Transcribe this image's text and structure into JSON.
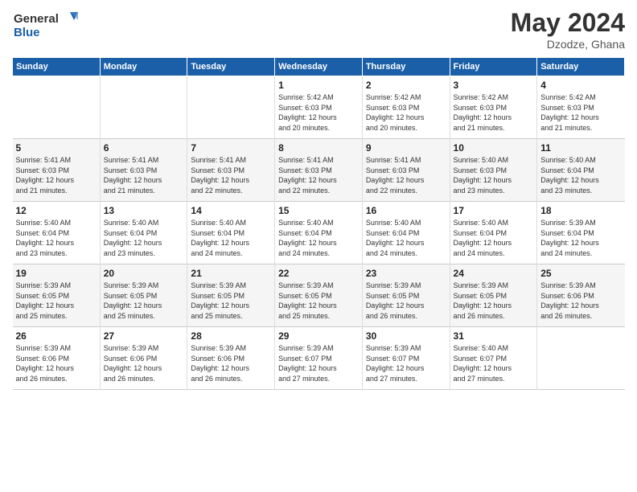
{
  "logo": {
    "line1": "General",
    "line2": "Blue"
  },
  "title": "May 2024",
  "location": "Dzodze, Ghana",
  "days_of_week": [
    "Sunday",
    "Monday",
    "Tuesday",
    "Wednesday",
    "Thursday",
    "Friday",
    "Saturday"
  ],
  "weeks": [
    [
      {
        "day": "",
        "info": ""
      },
      {
        "day": "",
        "info": ""
      },
      {
        "day": "",
        "info": ""
      },
      {
        "day": "1",
        "info": "Sunrise: 5:42 AM\nSunset: 6:03 PM\nDaylight: 12 hours\nand 20 minutes."
      },
      {
        "day": "2",
        "info": "Sunrise: 5:42 AM\nSunset: 6:03 PM\nDaylight: 12 hours\nand 20 minutes."
      },
      {
        "day": "3",
        "info": "Sunrise: 5:42 AM\nSunset: 6:03 PM\nDaylight: 12 hours\nand 21 minutes."
      },
      {
        "day": "4",
        "info": "Sunrise: 5:42 AM\nSunset: 6:03 PM\nDaylight: 12 hours\nand 21 minutes."
      }
    ],
    [
      {
        "day": "5",
        "info": "Sunrise: 5:41 AM\nSunset: 6:03 PM\nDaylight: 12 hours\nand 21 minutes."
      },
      {
        "day": "6",
        "info": "Sunrise: 5:41 AM\nSunset: 6:03 PM\nDaylight: 12 hours\nand 21 minutes."
      },
      {
        "day": "7",
        "info": "Sunrise: 5:41 AM\nSunset: 6:03 PM\nDaylight: 12 hours\nand 22 minutes."
      },
      {
        "day": "8",
        "info": "Sunrise: 5:41 AM\nSunset: 6:03 PM\nDaylight: 12 hours\nand 22 minutes."
      },
      {
        "day": "9",
        "info": "Sunrise: 5:41 AM\nSunset: 6:03 PM\nDaylight: 12 hours\nand 22 minutes."
      },
      {
        "day": "10",
        "info": "Sunrise: 5:40 AM\nSunset: 6:03 PM\nDaylight: 12 hours\nand 23 minutes."
      },
      {
        "day": "11",
        "info": "Sunrise: 5:40 AM\nSunset: 6:04 PM\nDaylight: 12 hours\nand 23 minutes."
      }
    ],
    [
      {
        "day": "12",
        "info": "Sunrise: 5:40 AM\nSunset: 6:04 PM\nDaylight: 12 hours\nand 23 minutes."
      },
      {
        "day": "13",
        "info": "Sunrise: 5:40 AM\nSunset: 6:04 PM\nDaylight: 12 hours\nand 23 minutes."
      },
      {
        "day": "14",
        "info": "Sunrise: 5:40 AM\nSunset: 6:04 PM\nDaylight: 12 hours\nand 24 minutes."
      },
      {
        "day": "15",
        "info": "Sunrise: 5:40 AM\nSunset: 6:04 PM\nDaylight: 12 hours\nand 24 minutes."
      },
      {
        "day": "16",
        "info": "Sunrise: 5:40 AM\nSunset: 6:04 PM\nDaylight: 12 hours\nand 24 minutes."
      },
      {
        "day": "17",
        "info": "Sunrise: 5:40 AM\nSunset: 6:04 PM\nDaylight: 12 hours\nand 24 minutes."
      },
      {
        "day": "18",
        "info": "Sunrise: 5:39 AM\nSunset: 6:04 PM\nDaylight: 12 hours\nand 24 minutes."
      }
    ],
    [
      {
        "day": "19",
        "info": "Sunrise: 5:39 AM\nSunset: 6:05 PM\nDaylight: 12 hours\nand 25 minutes."
      },
      {
        "day": "20",
        "info": "Sunrise: 5:39 AM\nSunset: 6:05 PM\nDaylight: 12 hours\nand 25 minutes."
      },
      {
        "day": "21",
        "info": "Sunrise: 5:39 AM\nSunset: 6:05 PM\nDaylight: 12 hours\nand 25 minutes."
      },
      {
        "day": "22",
        "info": "Sunrise: 5:39 AM\nSunset: 6:05 PM\nDaylight: 12 hours\nand 25 minutes."
      },
      {
        "day": "23",
        "info": "Sunrise: 5:39 AM\nSunset: 6:05 PM\nDaylight: 12 hours\nand 26 minutes."
      },
      {
        "day": "24",
        "info": "Sunrise: 5:39 AM\nSunset: 6:05 PM\nDaylight: 12 hours\nand 26 minutes."
      },
      {
        "day": "25",
        "info": "Sunrise: 5:39 AM\nSunset: 6:06 PM\nDaylight: 12 hours\nand 26 minutes."
      }
    ],
    [
      {
        "day": "26",
        "info": "Sunrise: 5:39 AM\nSunset: 6:06 PM\nDaylight: 12 hours\nand 26 minutes."
      },
      {
        "day": "27",
        "info": "Sunrise: 5:39 AM\nSunset: 6:06 PM\nDaylight: 12 hours\nand 26 minutes."
      },
      {
        "day": "28",
        "info": "Sunrise: 5:39 AM\nSunset: 6:06 PM\nDaylight: 12 hours\nand 26 minutes."
      },
      {
        "day": "29",
        "info": "Sunrise: 5:39 AM\nSunset: 6:07 PM\nDaylight: 12 hours\nand 27 minutes."
      },
      {
        "day": "30",
        "info": "Sunrise: 5:39 AM\nSunset: 6:07 PM\nDaylight: 12 hours\nand 27 minutes."
      },
      {
        "day": "31",
        "info": "Sunrise: 5:40 AM\nSunset: 6:07 PM\nDaylight: 12 hours\nand 27 minutes."
      },
      {
        "day": "",
        "info": ""
      }
    ]
  ]
}
